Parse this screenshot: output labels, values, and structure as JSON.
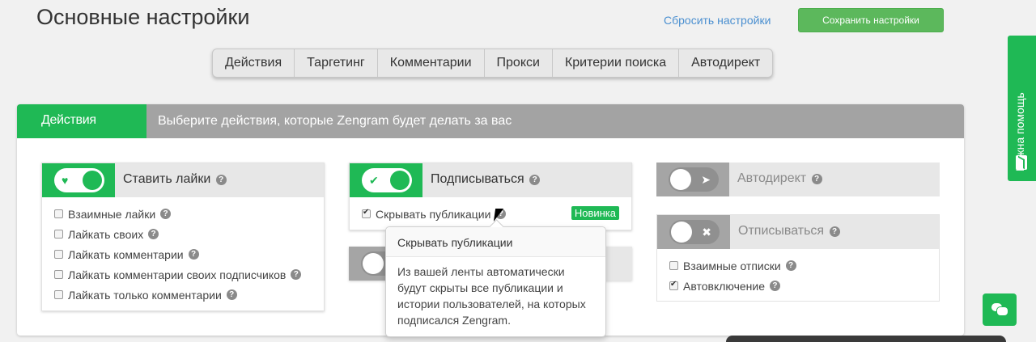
{
  "header": {
    "title": "Основные настройки",
    "reset_label": "Сбросить настройки",
    "save_label": "Сохранить настройки"
  },
  "tabs": [
    {
      "label": "Действия"
    },
    {
      "label": "Таргетинг"
    },
    {
      "label": "Комментарии"
    },
    {
      "label": "Прокси"
    },
    {
      "label": "Критерии поиска"
    },
    {
      "label": "Автодирект"
    }
  ],
  "help_side": {
    "label": "Нужна помощь",
    "icon": "help-arrow-icon"
  },
  "panel": {
    "title": "Действия",
    "description": "Выберите действия, которые Zengram будет делать за вас"
  },
  "cards": {
    "likes": {
      "title": "Ставить лайки",
      "enabled": true,
      "icon": "heart-icon",
      "options": [
        {
          "label": "Взаимные лайки",
          "checked": false
        },
        {
          "label": "Лайкать своих",
          "checked": false
        },
        {
          "label": "Лайкать комментарии",
          "checked": false
        },
        {
          "label": "Лайкать комментарии своих подписчиков",
          "checked": false
        },
        {
          "label": "Лайкать только комментарии",
          "checked": false
        }
      ]
    },
    "follow": {
      "title": "Подписываться",
      "enabled": true,
      "icon": "checkmark-icon",
      "badge": "Новинка",
      "options": [
        {
          "label": "Скрывать публикации",
          "checked": true
        }
      ]
    },
    "autodirect": {
      "title": "Автодирект",
      "enabled": false,
      "icon": "paper-plane-icon"
    },
    "unfollow": {
      "title": "Отписываться",
      "enabled": false,
      "icon": "cross-icon",
      "options": [
        {
          "label": "Взаимные отписки",
          "checked": false
        },
        {
          "label": "Автовключение",
          "checked": true
        }
      ]
    }
  },
  "tooltip": {
    "title": "Скрывать публикации",
    "body": "Из вашей ленты автоматически будут скрыты все публикации и истории пользователей, на которых подписался Zengram."
  },
  "colors": {
    "accent": "#1fb955",
    "save_button": "#5cb85c",
    "header_gray": "#a3a3a3",
    "link": "#4a8fd0"
  }
}
